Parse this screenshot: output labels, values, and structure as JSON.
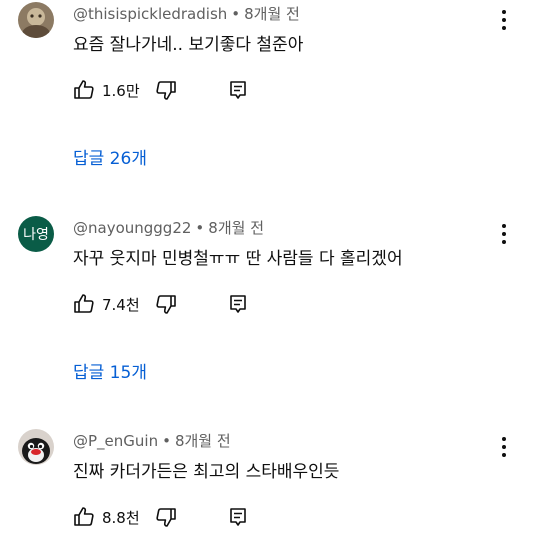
{
  "comments": [
    {
      "handle": "@thisispickledradish",
      "separator": "•",
      "time": "8개월 전",
      "text": "요즘 잘나가네.. 보기좋다 철준아",
      "likes": "1.6만",
      "replies": "답글 26개",
      "avatar": "photo"
    },
    {
      "handle": "@nayounggg22",
      "separator": "•",
      "time": "8개월 전",
      "text": "자꾸 웃지마 민병철ㅠㅠ 딴 사람들 다 홀리겠어",
      "likes": "7.4천",
      "replies": "답글 15개",
      "avatar": "letters",
      "avatar_letters": "나영",
      "avatar_color": "#0a5c47"
    },
    {
      "handle": "@P_enGuin",
      "separator": "•",
      "time": "8개월 전",
      "text": "진짜 카더가든은 최고의 스타배우인듯",
      "likes": "8.8천",
      "avatar": "penguin"
    }
  ],
  "colors": {
    "text": "#0f0f0f",
    "meta": "#606060",
    "link": "#065fd4"
  },
  "icons": [
    "thumbs-up-icon",
    "thumbs-down-icon",
    "reply-icon",
    "more-vert-icon"
  ]
}
